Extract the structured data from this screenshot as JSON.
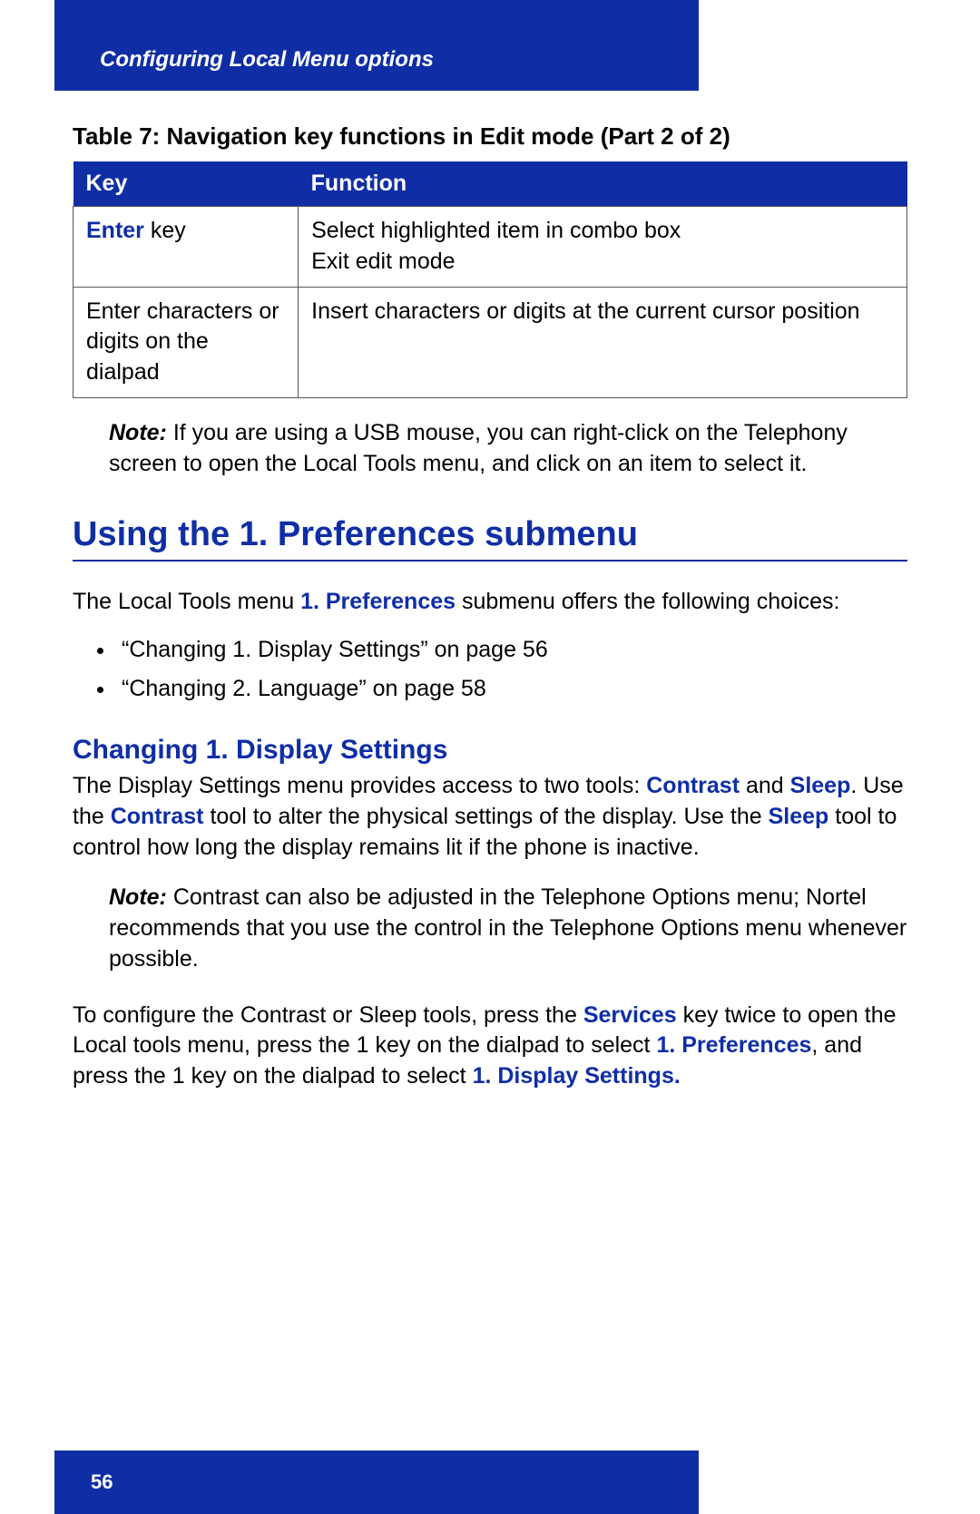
{
  "header": {
    "title": "Configuring Local Menu options"
  },
  "table": {
    "caption": "Table 7: Navigation key functions in Edit mode (Part 2 of 2)",
    "headers": {
      "key": "Key",
      "function": "Function"
    },
    "rows": [
      {
        "key_bold": "Enter",
        "key_rest": " key",
        "func_line1": "Select highlighted item in combo box",
        "func_line2": "Exit edit mode"
      },
      {
        "key_plain": "Enter characters or digits on the dialpad",
        "func": "Insert characters or digits at the current cursor position"
      }
    ]
  },
  "note1": {
    "label": "Note:",
    "text": " If you are using a USB mouse, you can right-click on the Telephony screen to open the Local Tools menu, and click on an item to select it."
  },
  "h1": "Using the 1. Preferences submenu",
  "intro": {
    "pre": "The Local Tools menu ",
    "bold": "1. Preferences",
    "post": " submenu offers the following choices:"
  },
  "bullets": [
    "“Changing 1. Display Settings” on page 56",
    "“Changing 2. Language” on page 58"
  ],
  "h2": "Changing 1. Display Settings",
  "para1": {
    "t0": "The Display Settings menu provides access to two tools: ",
    "b0": "Contrast",
    "t1": " and ",
    "b1": "Sleep",
    "t2": ". Use the ",
    "b2": "Contrast",
    "t3": " tool to alter the physical settings of the display. Use the ",
    "b3": "Sleep",
    "t4": " tool to control how long the display remains lit if the phone is inactive."
  },
  "note2": {
    "label": "Note:",
    "text": " Contrast can also be adjusted in the Telephone Options menu; Nortel recommends that you use the control in the Telephone Options menu whenever possible."
  },
  "para2": {
    "t0": "To configure the Contrast or Sleep tools, press the ",
    "b0": "Services",
    "t1": " key twice to open the Local tools menu, press the 1 key on the dialpad to select ",
    "b1": "1. Preferences",
    "t2": ", and press the 1 key on the dialpad to select ",
    "b2": "1. Display Settings."
  },
  "footer": {
    "page": "56"
  }
}
